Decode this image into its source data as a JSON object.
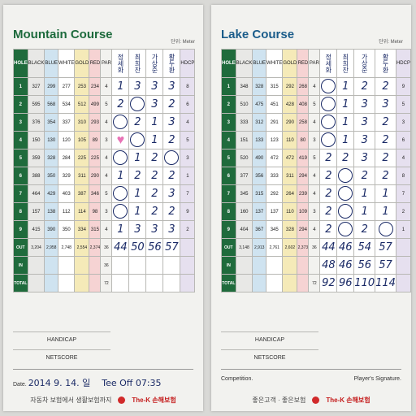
{
  "left": {
    "title": "Mountain Course",
    "unit": "단위: Meter",
    "headers": [
      "HOLE",
      "BLACK",
      "BLUE",
      "WHITE",
      "GOLD",
      "RED",
      "PAR",
      "정세화",
      "최희찬",
      "가상준",
      "황두환",
      "HDCP"
    ],
    "rows": [
      [
        "1",
        "327",
        "299",
        "277",
        "253",
        "234",
        "4",
        "1",
        "3",
        "3",
        "3",
        "8"
      ],
      [
        "2",
        "595",
        "568",
        "534",
        "512",
        "499",
        "5",
        "2",
        "○",
        "3",
        "2",
        "6"
      ],
      [
        "3",
        "376",
        "354",
        "337",
        "310",
        "293",
        "4",
        "○",
        "2",
        "1",
        "3",
        "4"
      ],
      [
        "4",
        "150",
        "130",
        "120",
        "105",
        "89",
        "3",
        "♥",
        "○",
        "1",
        "2",
        "5"
      ],
      [
        "5",
        "359",
        "328",
        "284",
        "225",
        "225",
        "4",
        "○",
        "1",
        "2",
        "○",
        "3"
      ],
      [
        "6",
        "388",
        "350",
        "329",
        "311",
        "290",
        "4",
        "1",
        "2",
        "2",
        "2",
        "1"
      ],
      [
        "7",
        "464",
        "429",
        "403",
        "387",
        "346",
        "5",
        "○",
        "1",
        "2",
        "3",
        "7"
      ],
      [
        "8",
        "157",
        "138",
        "112",
        "114",
        "98",
        "3",
        "○",
        "1",
        "2",
        "2",
        "9"
      ],
      [
        "9",
        "415",
        "390",
        "350",
        "334",
        "315",
        "4",
        "1",
        "3",
        "3",
        "3",
        "2"
      ],
      [
        "OUT",
        "3,204",
        "2,958",
        "2,748",
        "2,554",
        "2,374",
        "36",
        "44",
        "50",
        "56",
        "57",
        ""
      ],
      [
        "IN",
        "",
        "",
        "",
        "",
        "",
        "36",
        "",
        "",
        "",
        "",
        ""
      ],
      [
        "TOTAL",
        "",
        "",
        "",
        "",
        "",
        "72",
        "",
        "",
        "",
        "",
        ""
      ]
    ],
    "handicap": "HANDICAP",
    "netscore": "NETSCORE",
    "date_label": "Date.",
    "date_value": "2014 9. 14. 일",
    "teeoff": "Tee Off 07:35",
    "slogan": "자동차 보험에서 생활보험까지",
    "brand": "The-K 손해보험"
  },
  "right": {
    "title": "Lake Course",
    "unit": "단위: Meter",
    "headers": [
      "HOLE",
      "BLACK",
      "BLUE",
      "WHITE",
      "GOLD",
      "RED",
      "PAR",
      "정세화",
      "최희찬",
      "가상준",
      "황두환",
      "HDCP"
    ],
    "rows": [
      [
        "1",
        "348",
        "328",
        "315",
        "292",
        "268",
        "4",
        "○",
        "1",
        "2",
        "2",
        "9"
      ],
      [
        "2",
        "510",
        "475",
        "451",
        "428",
        "408",
        "5",
        "○",
        "1",
        "3",
        "3",
        "5"
      ],
      [
        "3",
        "333",
        "312",
        "291",
        "290",
        "258",
        "4",
        "○",
        "1",
        "3",
        "2",
        "3"
      ],
      [
        "4",
        "151",
        "133",
        "123",
        "110",
        "80",
        "3",
        "○",
        "1",
        "3",
        "2",
        "6"
      ],
      [
        "5",
        "520",
        "490",
        "472",
        "472",
        "419",
        "5",
        "2",
        "2",
        "3",
        "2",
        "4"
      ],
      [
        "6",
        "377",
        "356",
        "333",
        "311",
        "294",
        "4",
        "2",
        "○",
        "2",
        "2",
        "8"
      ],
      [
        "7",
        "345",
        "315",
        "292",
        "264",
        "239",
        "4",
        "2",
        "○",
        "1",
        "1",
        "7"
      ],
      [
        "8",
        "160",
        "137",
        "137",
        "110",
        "109",
        "3",
        "2",
        "○",
        "1",
        "1",
        "2"
      ],
      [
        "9",
        "404",
        "367",
        "345",
        "328",
        "294",
        "4",
        "2",
        "○",
        "2",
        "○",
        "1"
      ],
      [
        "OUT",
        "3,148",
        "2,913",
        "2,761",
        "2,602",
        "2,373",
        "36",
        "44",
        "46",
        "54",
        "57",
        ""
      ],
      [
        "IN",
        "",
        "",
        "",
        "",
        "",
        "",
        "48",
        "46",
        "56",
        "57",
        ""
      ],
      [
        "TOTAL",
        "",
        "",
        "",
        "",
        "",
        "72",
        "92",
        "96",
        "110",
        "114",
        ""
      ]
    ],
    "handicap": "HANDICAP",
    "netscore": "NETSCORE",
    "competition": "Competition.",
    "signature": "Player's Signature.",
    "slogan": "좋은고객 · 좋은보험",
    "brand": "The-K 손해보험"
  }
}
